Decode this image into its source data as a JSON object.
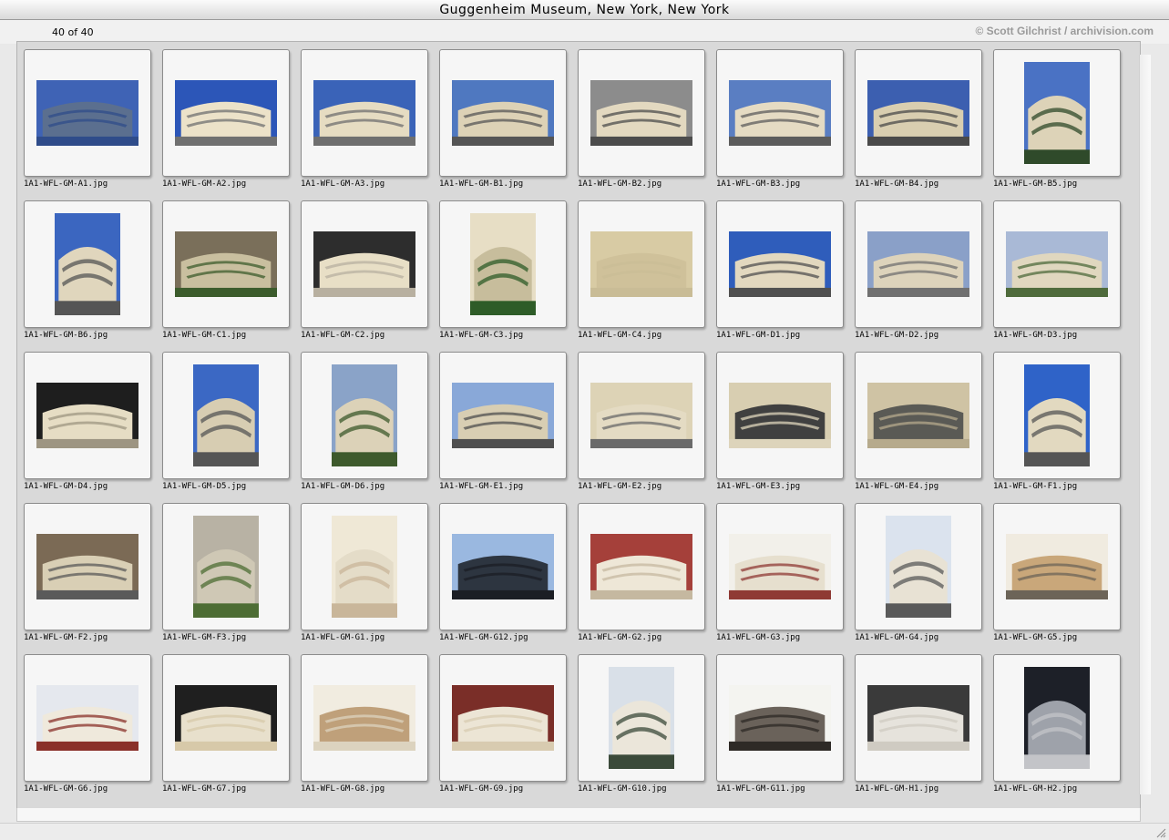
{
  "window": {
    "title": "Guggenheim Museum, New York, New York"
  },
  "header": {
    "count": "40 of 40",
    "credit": "© Scott Gilchrist / archivision.com"
  },
  "slides": [
    {
      "file": "1A1-WFL-GM-A1.jpg",
      "icon": "skyline-icon",
      "orient": "landscape",
      "sky": "#3f63b5",
      "wall": "#5b6f8f",
      "floor": "#2f4c8a"
    },
    {
      "file": "1A1-WFL-GM-A2.jpg",
      "icon": "spiral-building-icon",
      "orient": "landscape",
      "sky": "#2c56b8",
      "wall": "#ece2c9",
      "floor": "#707070"
    },
    {
      "file": "1A1-WFL-GM-A3.jpg",
      "icon": "spiral-building-icon",
      "orient": "landscape",
      "sky": "#3a63b8",
      "wall": "#e6dcc2",
      "floor": "#6f6f6f"
    },
    {
      "file": "1A1-WFL-GM-B1.jpg",
      "icon": "spiral-building-icon",
      "orient": "landscape",
      "sky": "#4f78c0",
      "wall": "#ddd2b6",
      "floor": "#555555"
    },
    {
      "file": "1A1-WFL-GM-B2.jpg",
      "icon": "spiral-building-icon",
      "orient": "landscape",
      "sky": "#8c8c8c",
      "wall": "#e3d9c0",
      "floor": "#4c4c4c"
    },
    {
      "file": "1A1-WFL-GM-B3.jpg",
      "icon": "spiral-building-icon",
      "orient": "landscape",
      "sky": "#5a7ec2",
      "wall": "#e5dbc3",
      "floor": "#5c5c5c"
    },
    {
      "file": "1A1-WFL-GM-B4.jpg",
      "icon": "spiral-building-icon",
      "orient": "landscape",
      "sky": "#3c5fb0",
      "wall": "#d9ceb0",
      "floor": "#4a4a4a"
    },
    {
      "file": "1A1-WFL-GM-B5.jpg",
      "icon": "spiral-building-icon",
      "orient": "portrait",
      "sky": "#4a72c4",
      "wall": "#ddd3b8",
      "floor": "#2f4a2a"
    },
    {
      "file": "1A1-WFL-GM-B6.jpg",
      "icon": "spiral-building-icon",
      "orient": "portrait",
      "sky": "#3b66c0",
      "wall": "#e0d6bd",
      "floor": "#555555"
    },
    {
      "file": "1A1-WFL-GM-C1.jpg",
      "icon": "entrance-icon",
      "orient": "landscape",
      "sky": "#7a6f5a",
      "wall": "#c9bf9f",
      "floor": "#3c5c2c"
    },
    {
      "file": "1A1-WFL-GM-C2.jpg",
      "icon": "entrance-icon",
      "orient": "landscape",
      "sky": "#2d2d2d",
      "wall": "#e8dfc6",
      "floor": "#b8b0a0"
    },
    {
      "file": "1A1-WFL-GM-C3.jpg",
      "icon": "entrance-icon",
      "orient": "portrait",
      "sky": "#e7dec5",
      "wall": "#c7bd9c",
      "floor": "#2e5c28"
    },
    {
      "file": "1A1-WFL-GM-C4.jpg",
      "icon": "plaque-icon",
      "orient": "landscape",
      "sky": "#d8cba4",
      "wall": "#cfc19a",
      "floor": "#c9bc96"
    },
    {
      "file": "1A1-WFL-GM-D1.jpg",
      "icon": "spiral-building-icon",
      "orient": "landscape",
      "sky": "#2f5dbb",
      "wall": "#e2d8bf",
      "floor": "#505050"
    },
    {
      "file": "1A1-WFL-GM-D2.jpg",
      "icon": "entrance-icon",
      "orient": "landscape",
      "sky": "#8aa0c8",
      "wall": "#ddd3bb",
      "floor": "#707070"
    },
    {
      "file": "1A1-WFL-GM-D3.jpg",
      "icon": "entrance-icon",
      "orient": "landscape",
      "sky": "#a9b9d6",
      "wall": "#e0d7bf",
      "floor": "#4f6b3c"
    },
    {
      "file": "1A1-WFL-GM-D4.jpg",
      "icon": "entrance-icon",
      "orient": "landscape",
      "sky": "#1e1e1e",
      "wall": "#e6ddc4",
      "floor": "#9d9582"
    },
    {
      "file": "1A1-WFL-GM-D5.jpg",
      "icon": "spiral-building-icon",
      "orient": "portrait",
      "sky": "#3b68c4",
      "wall": "#d7cdb2",
      "floor": "#555555"
    },
    {
      "file": "1A1-WFL-GM-D6.jpg",
      "icon": "tree-building-icon",
      "orient": "portrait",
      "sky": "#8aa3c8",
      "wall": "#dcd2b8",
      "floor": "#3e5a2c"
    },
    {
      "file": "1A1-WFL-GM-E1.jpg",
      "icon": "spiral-building-icon",
      "orient": "landscape",
      "sky": "#89a8d8",
      "wall": "#d8ceb3",
      "floor": "#4f4f4f"
    },
    {
      "file": "1A1-WFL-GM-E2.jpg",
      "icon": "facade-detail-icon",
      "orient": "landscape",
      "sky": "#ddd3b6",
      "wall": "#e4dbc3",
      "floor": "#6a6a6a"
    },
    {
      "file": "1A1-WFL-GM-E3.jpg",
      "icon": "facade-detail-icon",
      "orient": "landscape",
      "sky": "#d8ceb1",
      "wall": "#404040",
      "floor": "#ddd4bb"
    },
    {
      "file": "1A1-WFL-GM-E4.jpg",
      "icon": "facade-detail-icon",
      "orient": "landscape",
      "sky": "#cfc3a4",
      "wall": "#5a5a55",
      "floor": "#b6aa8c"
    },
    {
      "file": "1A1-WFL-GM-F1.jpg",
      "icon": "spiral-building-icon",
      "orient": "portrait",
      "sky": "#2f63c8",
      "wall": "#e2d9c0",
      "floor": "#555555"
    },
    {
      "file": "1A1-WFL-GM-F2.jpg",
      "icon": "spiral-building-icon",
      "orient": "landscape",
      "sky": "#7b6a55",
      "wall": "#d9cfb5",
      "floor": "#5a5a5a"
    },
    {
      "file": "1A1-WFL-GM-F3.jpg",
      "icon": "tree-building-icon",
      "orient": "portrait",
      "sky": "#b8b2a4",
      "wall": "#cfc8b5",
      "floor": "#4d6d34"
    },
    {
      "file": "1A1-WFL-GM-G1.jpg",
      "icon": "interior-ramp-icon",
      "orient": "portrait",
      "sky": "#efe8d6",
      "wall": "#e4dcc8",
      "floor": "#c9b69a"
    },
    {
      "file": "1A1-WFL-GM-G12.jpg",
      "icon": "skylight-icon",
      "orient": "landscape",
      "sky": "#9ab8e0",
      "wall": "#2d3540",
      "floor": "#1b1e24"
    },
    {
      "file": "1A1-WFL-GM-G2.jpg",
      "icon": "interior-ramp-icon",
      "orient": "landscape",
      "sky": "#a5403a",
      "wall": "#eee7d7",
      "floor": "#c5b8a0"
    },
    {
      "file": "1A1-WFL-GM-G3.jpg",
      "icon": "interior-ramp-icon",
      "orient": "landscape",
      "sky": "#f2f0ea",
      "wall": "#e6dfce",
      "floor": "#8f3a34"
    },
    {
      "file": "1A1-WFL-GM-G4.jpg",
      "icon": "interior-ramp-icon",
      "orient": "portrait",
      "sky": "#dbe3ee",
      "wall": "#e8e2d4",
      "floor": "#5a5a5a"
    },
    {
      "file": "1A1-WFL-GM-G5.jpg",
      "icon": "interior-ramp-icon",
      "orient": "landscape",
      "sky": "#f0ebe0",
      "wall": "#c9a77a",
      "floor": "#6c6458"
    },
    {
      "file": "1A1-WFL-GM-G6.jpg",
      "icon": "interior-ramp-icon",
      "orient": "landscape",
      "sky": "#e5e8ee",
      "wall": "#efe9dc",
      "floor": "#8a3029"
    },
    {
      "file": "1A1-WFL-GM-G7.jpg",
      "icon": "interior-ramp-icon",
      "orient": "landscape",
      "sky": "#1f1f1f",
      "wall": "#e8e0cc",
      "floor": "#d7c9a9"
    },
    {
      "file": "1A1-WFL-GM-G8.jpg",
      "icon": "interior-ramp-icon",
      "orient": "landscape",
      "sky": "#f1ece0",
      "wall": "#bfa07a",
      "floor": "#dcd3bf"
    },
    {
      "file": "1A1-WFL-GM-G9.jpg",
      "icon": "interior-ramp-icon",
      "orient": "landscape",
      "sky": "#7a2e28",
      "wall": "#ece5d5",
      "floor": "#d8cbb0"
    },
    {
      "file": "1A1-WFL-GM-G10.jpg",
      "icon": "interior-ramp-icon",
      "orient": "portrait",
      "sky": "#d9e0e8",
      "wall": "#ebe6da",
      "floor": "#3b4a3a"
    },
    {
      "file": "1A1-WFL-GM-G11.jpg",
      "icon": "skylight-icon",
      "orient": "landscape",
      "sky": "#f4f4f0",
      "wall": "#6a625a",
      "floor": "#2e2a26"
    },
    {
      "file": "1A1-WFL-GM-H1.jpg",
      "icon": "interior-ramp-icon",
      "orient": "landscape",
      "sky": "#3a3a3a",
      "wall": "#e6e3dc",
      "floor": "#cfcbc2"
    },
    {
      "file": "1A1-WFL-GM-H2.jpg",
      "icon": "interior-ramp-icon",
      "orient": "portrait",
      "sky": "#1d2028",
      "wall": "#9ea2aa",
      "floor": "#c3c4c8"
    }
  ]
}
